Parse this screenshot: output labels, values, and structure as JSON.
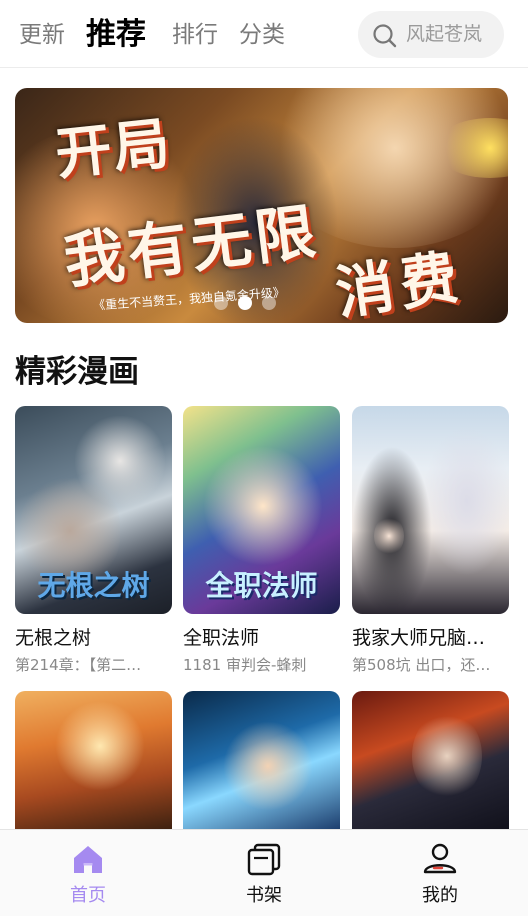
{
  "header": {
    "tabs": [
      {
        "label": "更新",
        "active": false
      },
      {
        "label": "推荐",
        "active": true
      },
      {
        "label": "排行",
        "active": false
      },
      {
        "label": "分类",
        "active": false
      }
    ],
    "search": {
      "placeholder": "风起苍岚",
      "icon": "search-icon"
    }
  },
  "banner": {
    "line1": "开局",
    "line2": "我有无限",
    "line3": "消费",
    "subtitle": "《重生不当赘王，我独自氪金升级》",
    "active_dot": 2,
    "dot_count": 3
  },
  "section": {
    "title": "精彩漫画"
  },
  "comics": [
    {
      "title": "无根之树",
      "subtitle": "第214章：【第二…",
      "cover_logo": "无根之树"
    },
    {
      "title": "全职法师",
      "subtitle": "1181 审判会-蜂刺",
      "cover_logo": "全职法师"
    },
    {
      "title": "我家大师兄脑…",
      "subtitle": "第508坑 出口，还…",
      "cover_logo": ""
    }
  ],
  "bottom_nav": [
    {
      "label": "首页",
      "icon": "home-icon",
      "active": true
    },
    {
      "label": "书架",
      "icon": "bookshelf-icon",
      "active": false
    },
    {
      "label": "我的",
      "icon": "profile-icon",
      "active": false
    }
  ],
  "colors": {
    "accent": "#a58af0",
    "muted": "#888888"
  }
}
